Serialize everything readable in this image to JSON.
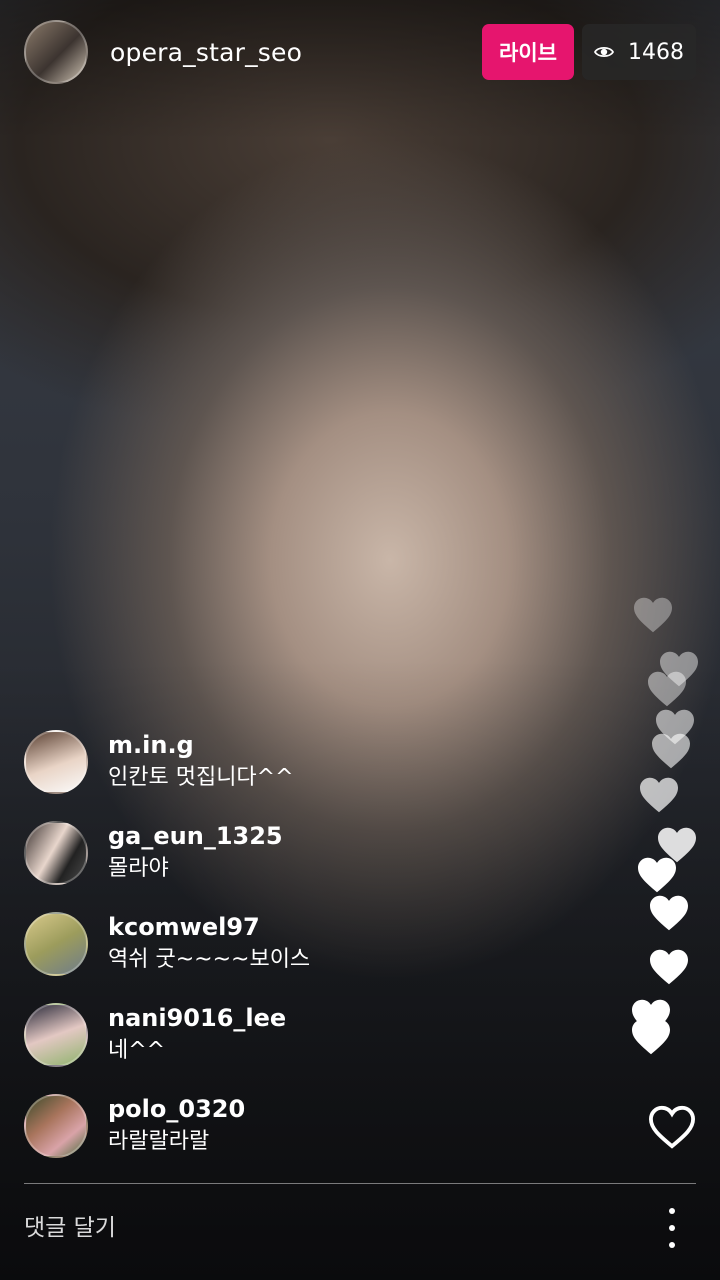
{
  "header": {
    "username": "opera_star_seo",
    "live_label": "라이브",
    "viewer_count": "1468",
    "eye_icon": "eye-icon"
  },
  "comments": [
    {
      "name": "m.in.g",
      "text": "인칸토 멋집니다^^"
    },
    {
      "name": "ga_eun_1325",
      "text": "몰라야"
    },
    {
      "name": "kcomwel97",
      "text": "역쉬 굿~~~~보이스"
    },
    {
      "name": "nani9016_lee",
      "text": "네^^"
    },
    {
      "name": "polo_0320",
      "text": "라랄랄라랄"
    }
  ],
  "footer": {
    "comment_placeholder": "댓글 달기",
    "like_icon": "heart-outline-icon",
    "more_icon": "more-vertical-icon"
  },
  "colors": {
    "live_accent": "#e6156e",
    "heart": "#ffffff"
  }
}
